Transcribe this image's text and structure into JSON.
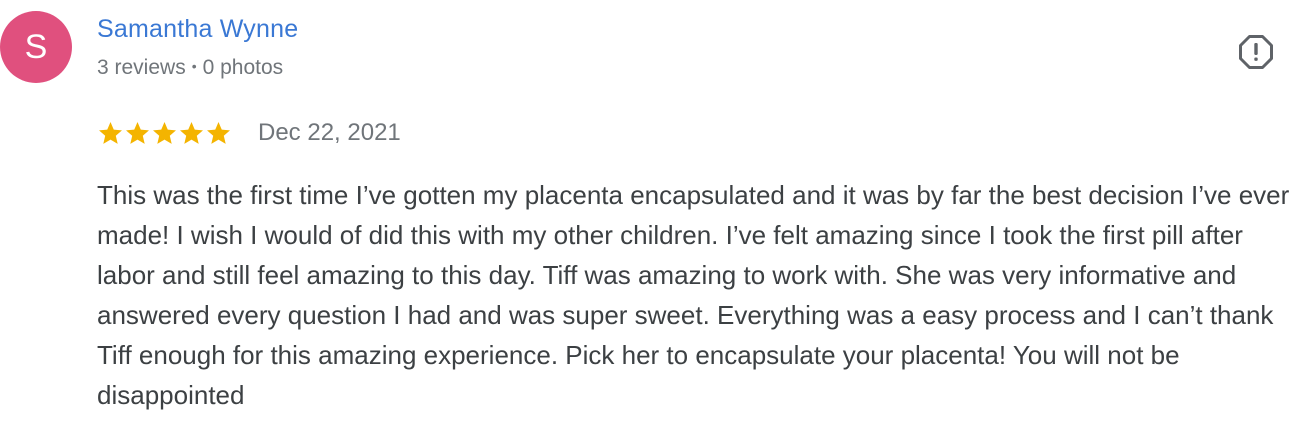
{
  "reviewer": {
    "avatar_initial": "S",
    "avatar_color": "#e0507e",
    "name": "Samantha Wynne",
    "name_color": "#3a78d4",
    "reviews_count": "3 reviews",
    "separator": "•",
    "photos_count": "0 photos"
  },
  "review": {
    "rating": 5,
    "rating_max": 5,
    "star_color": "#f4b400",
    "date": "Dec 22, 2021",
    "text": "This was the first time I’ve gotten my placenta encapsulated and it was by far the best decision I’ve ever made! I wish I would of did this with my other children. I’ve felt amazing since I took the first pill after labor and still feel amazing to this day. Tiff was amazing to work with. She was very informative and answered every question I had and was super sweet. Everything was a easy process and I can’t thank Tiff enough for this amazing experience. Pick her to encapsulate your placenta! You will not be disappointed"
  },
  "actions": {
    "flag_icon": "report-flag-icon"
  }
}
